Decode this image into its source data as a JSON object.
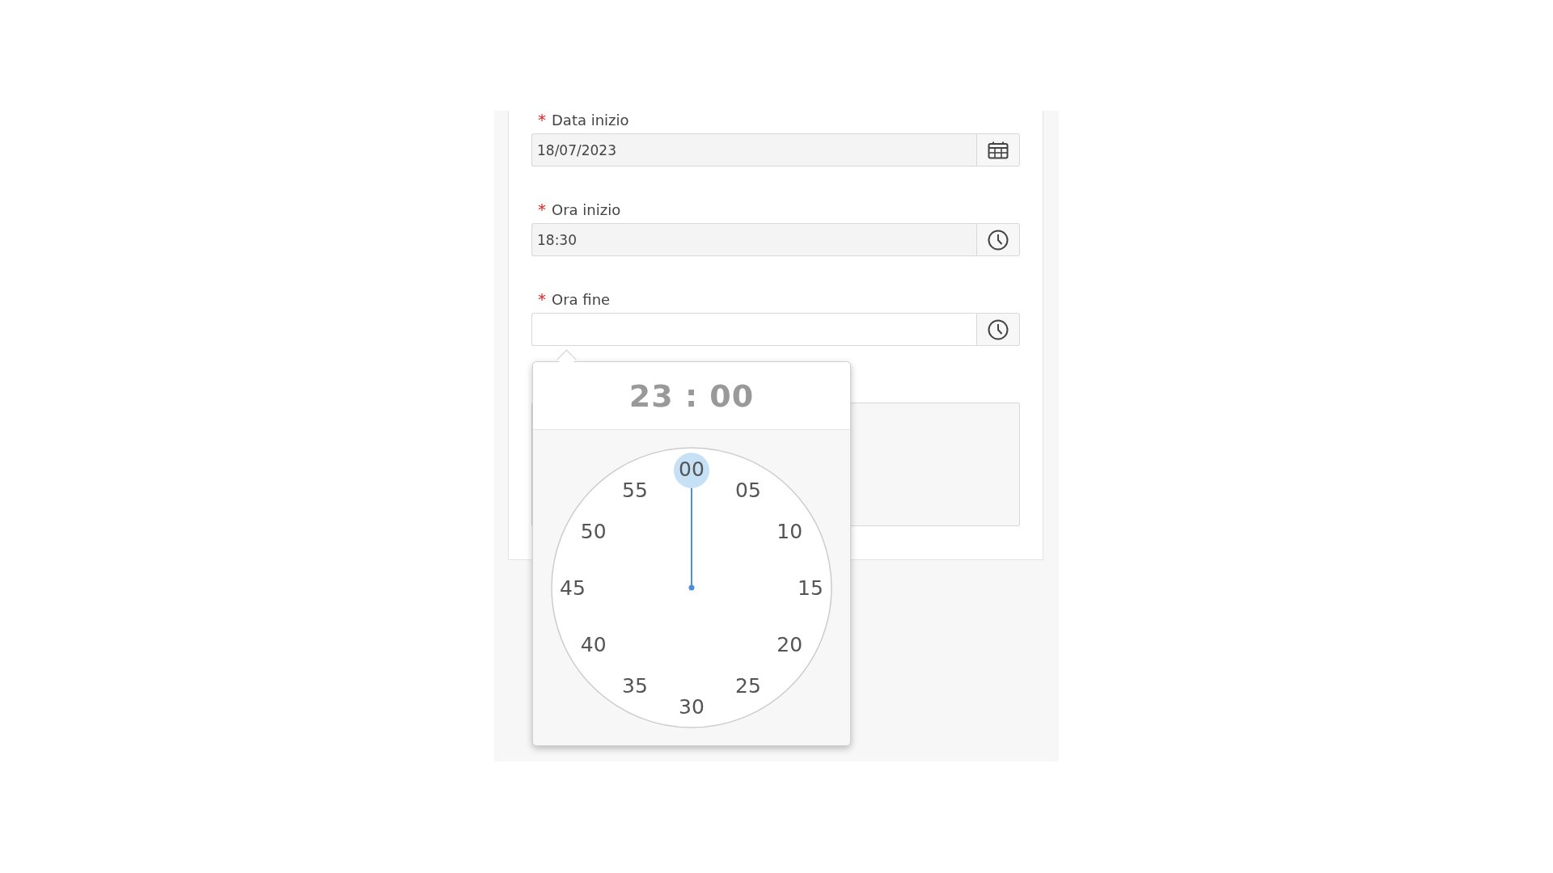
{
  "fields": [
    {
      "label": "Data inizio",
      "required_mark": "*",
      "value": "18/07/2023",
      "kind": "date",
      "disabled": true
    },
    {
      "label": "Ora inizio",
      "required_mark": "*",
      "value": "18:30",
      "kind": "time",
      "disabled": true
    },
    {
      "label": "Ora fine",
      "required_mark": "*",
      "kind": "time",
      "disabled": false,
      "time_picker": {
        "display": "23 : 00",
        "minutes": [
          {
            "label": "00",
            "selected": true
          },
          {
            "label": "05",
            "selected": false
          },
          {
            "label": "10",
            "selected": false
          },
          {
            "label": "15",
            "selected": false
          },
          {
            "label": "20",
            "selected": false
          },
          {
            "label": "25",
            "selected": false
          },
          {
            "label": "30",
            "selected": false
          },
          {
            "label": "35",
            "selected": false
          },
          {
            "label": "40",
            "selected": false
          },
          {
            "label": "45",
            "selected": false
          },
          {
            "label": "50",
            "selected": false
          },
          {
            "label": "55",
            "selected": false
          }
        ]
      }
    }
  ]
}
